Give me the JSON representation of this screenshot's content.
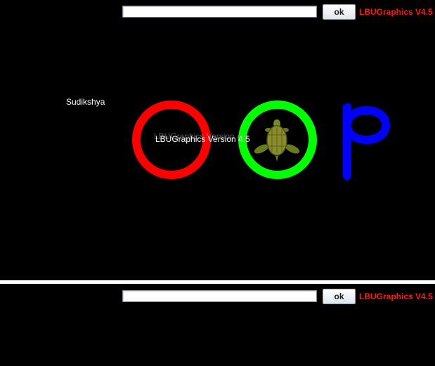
{
  "top_panel": {
    "input_value": "",
    "ok_label": "ok",
    "version_label": "LBUGraphics V4.5"
  },
  "canvas": {
    "name_text": "Sudikshya",
    "watermark_text": "LBUGraphics Version 4.5",
    "shapes": [
      {
        "kind": "ring",
        "color": "#ff0000"
      },
      {
        "kind": "ring",
        "color": "#00ff00"
      },
      {
        "kind": "letter",
        "text": "p",
        "color": "#0000ff"
      }
    ],
    "turtle_icon": "turtle-icon"
  },
  "bottom_panel": {
    "input_value": "",
    "ok_label": "ok",
    "version_label": "LBUGraphics V4.5"
  }
}
